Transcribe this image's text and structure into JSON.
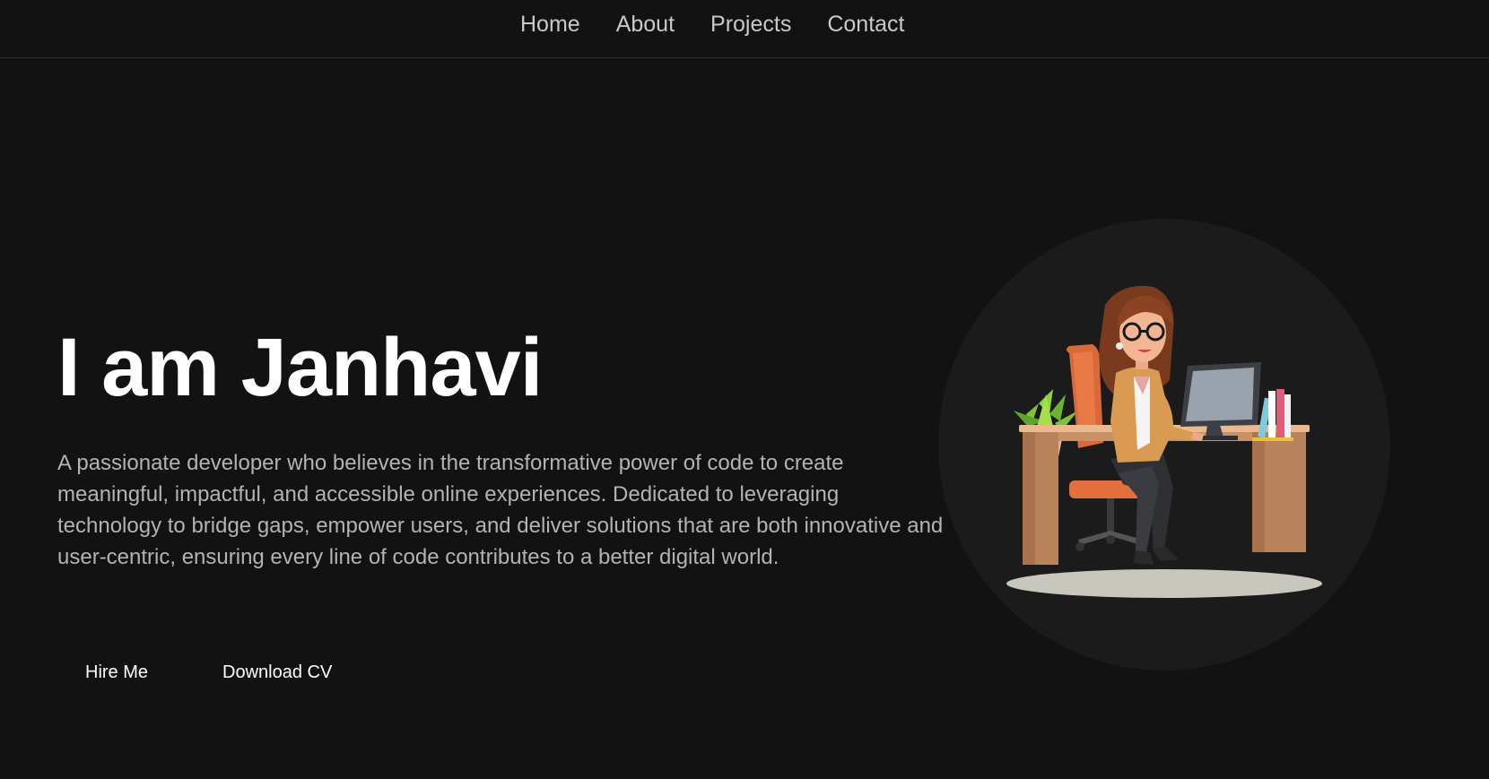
{
  "nav": {
    "items": [
      {
        "label": "Home"
      },
      {
        "label": "About"
      },
      {
        "label": "Projects"
      },
      {
        "label": "Contact"
      }
    ]
  },
  "hero": {
    "title": "I am Janhavi",
    "description": "A passionate developer who believes in the transformative power of code to create meaningful, impactful, and accessible online experiences. Dedicated to leveraging technology to bridge gaps, empower users, and deliver solutions that are both innovative and user-centric, ensuring every line of code contributes to a better digital world.",
    "hire_label": "Hire Me",
    "cv_label": "Download CV"
  },
  "colors": {
    "background": "#121212",
    "circle": "#1b1b1b",
    "text_primary": "#ffffff",
    "text_secondary": "#b3b3b3",
    "nav_text": "#c9c9c9"
  },
  "illustration": {
    "subject": "woman-at-desk-with-computer-illustration"
  }
}
